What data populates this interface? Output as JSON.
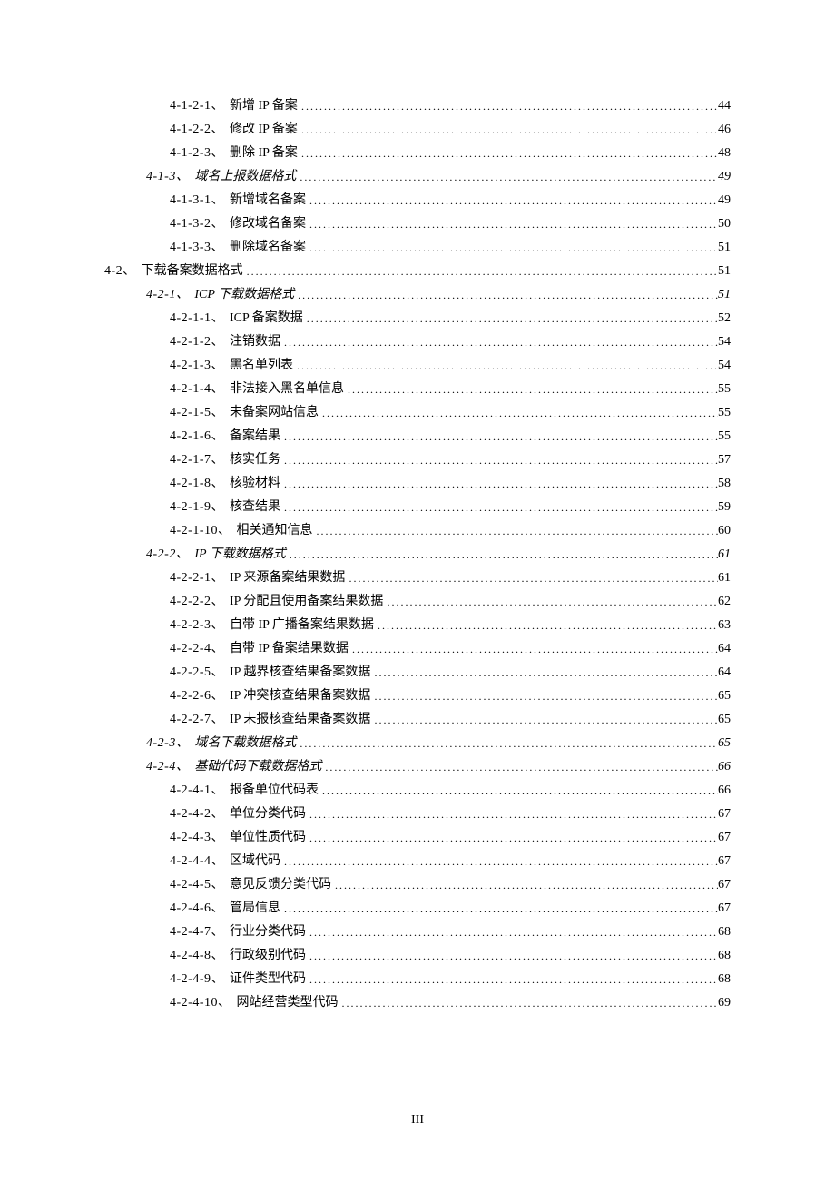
{
  "toc": [
    {
      "level": 3,
      "style": "normal",
      "num": "4-1-2-1、",
      "title": "新增 IP 备案",
      "page": "44"
    },
    {
      "level": 3,
      "style": "normal",
      "num": "4-1-2-2、",
      "title": "修改 IP 备案",
      "page": "46"
    },
    {
      "level": 3,
      "style": "normal",
      "num": "4-1-2-3、",
      "title": "删除 IP 备案",
      "page": "48"
    },
    {
      "level": 2,
      "style": "italic",
      "num": "4-1-3、",
      "title": "域名上报数据格式",
      "page": "49"
    },
    {
      "level": 3,
      "style": "normal",
      "num": "4-1-3-1、",
      "title": "新增域名备案",
      "page": "49"
    },
    {
      "level": 3,
      "style": "normal",
      "num": "4-1-3-2、",
      "title": "修改域名备案",
      "page": "50"
    },
    {
      "level": 3,
      "style": "normal",
      "num": "4-1-3-3、",
      "title": "删除域名备案",
      "page": "51"
    },
    {
      "level": 1,
      "style": "normal",
      "num": "4-2、",
      "title": "下载备案数据格式",
      "page": "51"
    },
    {
      "level": 2,
      "style": "italic",
      "num": "4-2-1、",
      "title": "ICP 下载数据格式",
      "page": "51"
    },
    {
      "level": 3,
      "style": "normal",
      "num": "4-2-1-1、",
      "title": "ICP 备案数据",
      "page": "52"
    },
    {
      "level": 3,
      "style": "normal",
      "num": "4-2-1-2、",
      "title": "注销数据",
      "page": "54"
    },
    {
      "level": 3,
      "style": "normal",
      "num": "4-2-1-3、",
      "title": "黑名单列表",
      "page": "54"
    },
    {
      "level": 3,
      "style": "normal",
      "num": "4-2-1-4、",
      "title": "非法接入黑名单信息",
      "page": "55"
    },
    {
      "level": 3,
      "style": "normal",
      "num": "4-2-1-5、",
      "title": "未备案网站信息",
      "page": "55"
    },
    {
      "level": 3,
      "style": "normal",
      "num": "4-2-1-6、",
      "title": "备案结果",
      "page": "55"
    },
    {
      "level": 3,
      "style": "normal",
      "num": "4-2-1-7、",
      "title": "核实任务",
      "page": "57"
    },
    {
      "level": 3,
      "style": "normal",
      "num": "4-2-1-8、",
      "title": "核验材料",
      "page": "58"
    },
    {
      "level": 3,
      "style": "normal",
      "num": "4-2-1-9、",
      "title": "核查结果",
      "page": "59"
    },
    {
      "level": 3,
      "style": "normal",
      "num": "4-2-1-10、",
      "title": "相关通知信息",
      "page": "60"
    },
    {
      "level": 2,
      "style": "italic",
      "num": "4-2-2、",
      "title": "IP 下载数据格式",
      "page": "61"
    },
    {
      "level": 3,
      "style": "normal",
      "num": "4-2-2-1、",
      "title": "IP 来源备案结果数据",
      "page": "61"
    },
    {
      "level": 3,
      "style": "normal",
      "num": "4-2-2-2、",
      "title": "IP 分配且使用备案结果数据",
      "page": "62"
    },
    {
      "level": 3,
      "style": "normal",
      "num": "4-2-2-3、",
      "title": "自带 IP 广播备案结果数据",
      "page": "63"
    },
    {
      "level": 3,
      "style": "normal",
      "num": "4-2-2-4、",
      "title": "自带 IP 备案结果数据",
      "page": "64"
    },
    {
      "level": 3,
      "style": "normal",
      "num": "4-2-2-5、",
      "title": "IP 越界核查结果备案数据",
      "page": "64"
    },
    {
      "level": 3,
      "style": "normal",
      "num": "4-2-2-6、",
      "title": "IP 冲突核查结果备案数据",
      "page": "65"
    },
    {
      "level": 3,
      "style": "normal",
      "num": "4-2-2-7、",
      "title": "IP 未报核查结果备案数据",
      "page": "65"
    },
    {
      "level": 2,
      "style": "italic",
      "num": "4-2-3、",
      "title": "域名下载数据格式",
      "page": "65"
    },
    {
      "level": 2,
      "style": "italic",
      "num": "4-2-4、",
      "title": "基础代码下载数据格式",
      "page": "66"
    },
    {
      "level": 3,
      "style": "normal",
      "num": "4-2-4-1、",
      "title": "报备单位代码表",
      "page": "66"
    },
    {
      "level": 3,
      "style": "normal",
      "num": "4-2-4-2、",
      "title": "单位分类代码",
      "page": "67"
    },
    {
      "level": 3,
      "style": "normal",
      "num": "4-2-4-3、",
      "title": "单位性质代码",
      "page": "67"
    },
    {
      "level": 3,
      "style": "normal",
      "num": "4-2-4-4、",
      "title": "区域代码",
      "page": "67"
    },
    {
      "level": 3,
      "style": "normal",
      "num": "4-2-4-5、",
      "title": "意见反馈分类代码",
      "page": "67"
    },
    {
      "level": 3,
      "style": "normal",
      "num": "4-2-4-6、",
      "title": "管局信息",
      "page": "67"
    },
    {
      "level": 3,
      "style": "normal",
      "num": "4-2-4-7、",
      "title": "行业分类代码",
      "page": "68"
    },
    {
      "level": 3,
      "style": "normal",
      "num": "4-2-4-8、",
      "title": "行政级别代码",
      "page": "68"
    },
    {
      "level": 3,
      "style": "normal",
      "num": "4-2-4-9、",
      "title": "证件类型代码",
      "page": "68"
    },
    {
      "level": 3,
      "style": "normal",
      "num": "4-2-4-10、",
      "title": "网站经营类型代码",
      "page": "69"
    }
  ],
  "footer": {
    "page_number": "III"
  }
}
